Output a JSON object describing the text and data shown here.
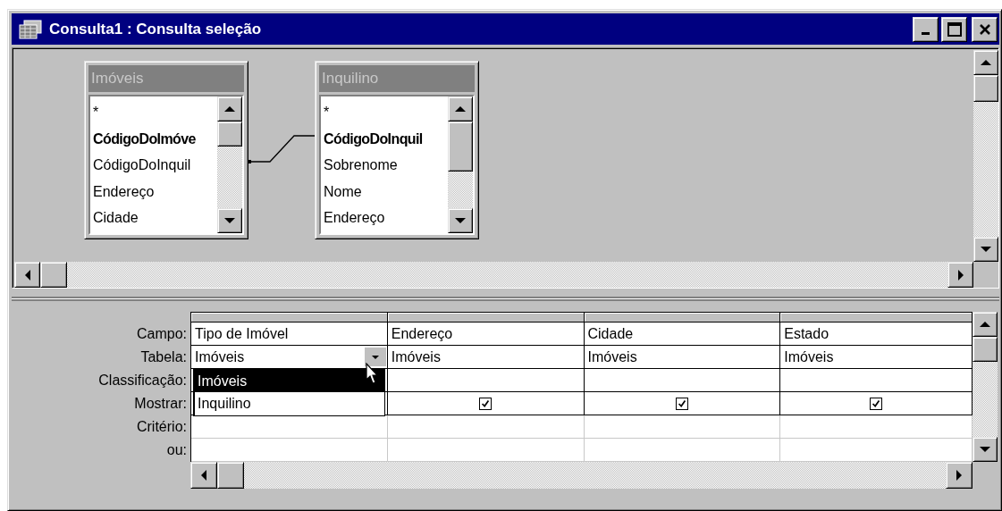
{
  "window": {
    "title": "Consulta1 : Consulta seleção"
  },
  "tables": [
    {
      "name": "Imóveis",
      "fields": [
        {
          "name": "*",
          "key": false
        },
        {
          "name": "CódigoDoImóve",
          "key": true
        },
        {
          "name": "CódigoDoInquil",
          "key": false
        },
        {
          "name": "Endereço",
          "key": false
        },
        {
          "name": "Cidade",
          "key": false
        }
      ]
    },
    {
      "name": "Inquilino",
      "fields": [
        {
          "name": "*",
          "key": false
        },
        {
          "name": "CódigoDoInquil",
          "key": true
        },
        {
          "name": "Sobrenome",
          "key": false
        },
        {
          "name": "Nome",
          "key": false
        },
        {
          "name": "Endereço",
          "key": false
        }
      ]
    }
  ],
  "grid": {
    "row_labels": [
      "Campo:",
      "Tabela:",
      "Classificação:",
      "Mostrar:",
      "Critério:",
      "ou:"
    ],
    "columns": [
      {
        "field": "Tipo de Imóvel",
        "table": "Imóveis"
      },
      {
        "field": "Endereço",
        "table": "Imóveis",
        "show": true
      },
      {
        "field": "Cidade",
        "table": "Imóveis",
        "show": true
      },
      {
        "field": "Estado",
        "table": "Imóveis",
        "show": true
      }
    ]
  },
  "dropdown": {
    "options": [
      {
        "label": "Imóveis",
        "selected": true
      },
      {
        "label": "Inquilino",
        "selected": false
      }
    ]
  }
}
